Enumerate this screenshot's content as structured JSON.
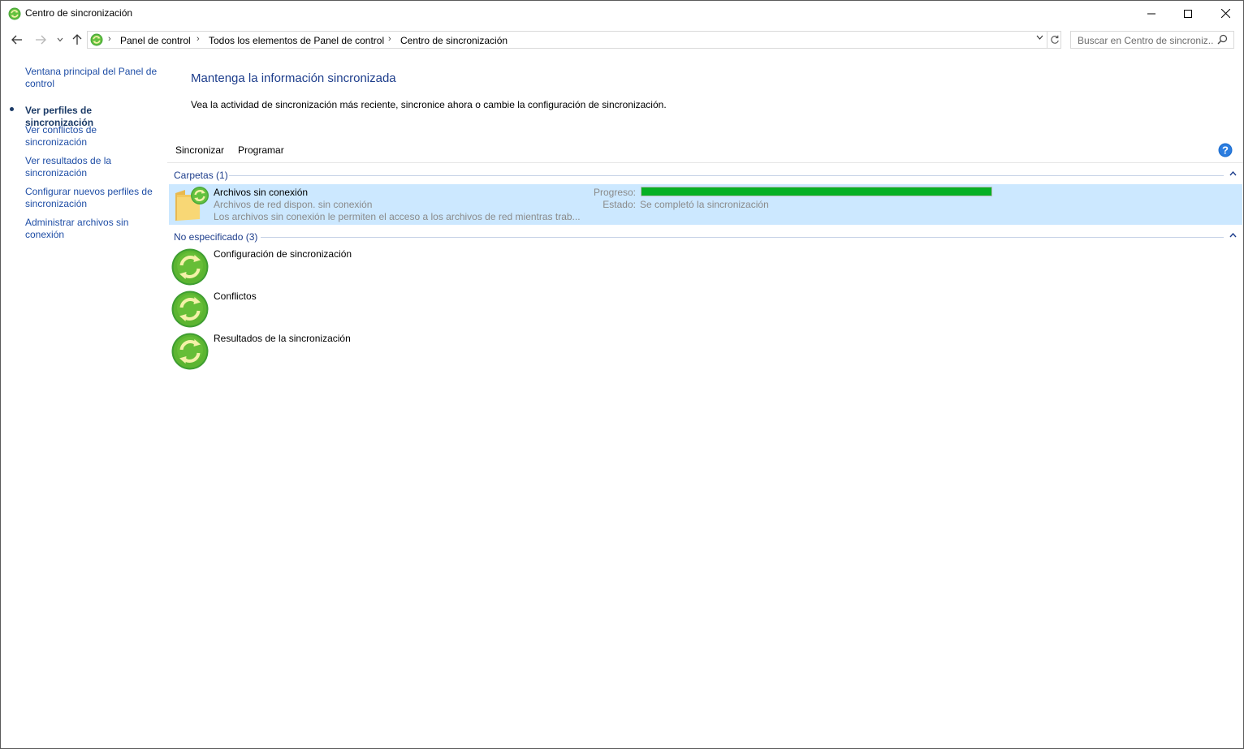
{
  "window": {
    "title": "Centro de sincronización"
  },
  "address": {
    "crumbs": [
      "Panel de control",
      "Todos los elementos de Panel de control",
      "Centro de sincronización"
    ]
  },
  "search": {
    "placeholder": "Buscar en Centro de sincroniz..."
  },
  "sidebar": {
    "items": [
      {
        "label_line1": "Ventana principal del Panel de",
        "label_line2": "control",
        "active": false
      },
      {
        "label_line1": "Ver perfiles de sincronización",
        "label_line2": "",
        "active": true
      },
      {
        "label_line1": "Ver conflictos de",
        "label_line2": "sincronización",
        "active": false
      },
      {
        "label_line1": "Ver resultados de la",
        "label_line2": "sincronización",
        "active": false
      },
      {
        "label_line1": "Configurar nuevos perfiles de",
        "label_line2": "sincronización",
        "active": false
      },
      {
        "label_line1": "Administrar archivos sin",
        "label_line2": "conexión",
        "active": false
      }
    ]
  },
  "main": {
    "heading": "Mantenga la información sincronizada",
    "subtext": "Vea la actividad de sincronización más reciente, sincronice ahora o cambie la configuración de sincronización."
  },
  "toolbar": {
    "sync_label": "Sincronizar",
    "schedule_label": "Programar"
  },
  "groups": {
    "folders": {
      "header": "Carpetas (1)",
      "item": {
        "title": "Archivos sin conexión",
        "subtitle": "Archivos de red dispon. sin conexión",
        "description": "Los archivos sin conexión le permiten el acceso a los archivos de red mientras trab...",
        "progress_label": "Progreso:",
        "progress": 1.0,
        "status_label": "Estado:",
        "status": "Se completó la sincronización"
      }
    },
    "unspecified": {
      "header": "No especificado (3)",
      "items": [
        {
          "title": "Configuración de sincronización"
        },
        {
          "title": "Conflictos"
        },
        {
          "title": "Resultados de la sincronización"
        }
      ]
    }
  },
  "colors": {
    "link": "#1f4ea6",
    "heading": "#1e3e8c",
    "selection": "#cce8ff",
    "progress": "#06b025",
    "sync_icon": "#5cb531"
  },
  "icons": {
    "title": "sync-center-icon",
    "back": "arrow-left-icon",
    "forward": "arrow-right-icon",
    "recent": "chevron-down-icon",
    "up": "arrow-up-icon",
    "search": "search-icon",
    "help": "help-icon",
    "folder": "offline-folder-icon",
    "sync": "sync-icon"
  }
}
